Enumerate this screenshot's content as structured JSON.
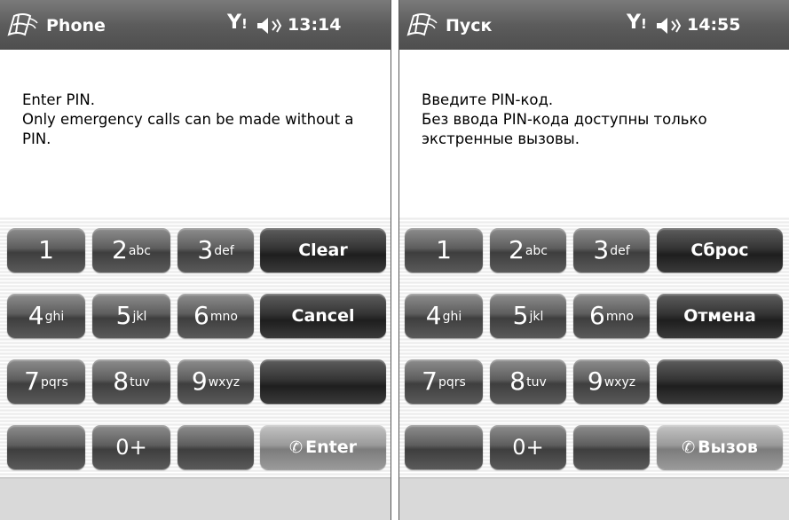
{
  "panels": [
    {
      "title": "Phone",
      "time": "13:14",
      "message_lines": [
        "Enter PIN.",
        "Only emergency calls can be made without a PIN."
      ],
      "keys": {
        "k1": "1",
        "k2": {
          "digit": "2",
          "letters": "abc"
        },
        "k3": {
          "digit": "3",
          "letters": "def"
        },
        "k4": {
          "digit": "4",
          "letters": "ghi"
        },
        "k5": {
          "digit": "5",
          "letters": "jkl"
        },
        "k6": {
          "digit": "6",
          "letters": "mno"
        },
        "k7": {
          "digit": "7",
          "letters": "pqrs"
        },
        "k8": {
          "digit": "8",
          "letters": "tuv"
        },
        "k9": {
          "digit": "9",
          "letters": "wxyz"
        },
        "k0": "0+",
        "clear": "Clear",
        "cancel": "Cancel",
        "enter": "Enter"
      }
    },
    {
      "title": "Пуск",
      "time": "14:55",
      "message_lines": [
        "Введите PIN-код.",
        "Без ввода PIN-кода доступны только экстренные вызовы."
      ],
      "keys": {
        "k1": "1",
        "k2": {
          "digit": "2",
          "letters": "abc"
        },
        "k3": {
          "digit": "3",
          "letters": "def"
        },
        "k4": {
          "digit": "4",
          "letters": "ghi"
        },
        "k5": {
          "digit": "5",
          "letters": "jkl"
        },
        "k6": {
          "digit": "6",
          "letters": "mno"
        },
        "k7": {
          "digit": "7",
          "letters": "pqrs"
        },
        "k8": {
          "digit": "8",
          "letters": "tuv"
        },
        "k9": {
          "digit": "9",
          "letters": "wxyz"
        },
        "k0": "0+",
        "clear": "Сброс",
        "cancel": "Отмена",
        "enter": "Вызов"
      }
    }
  ],
  "icons": {
    "start": "windows-flag-icon",
    "signal": "signal-antenna-icon",
    "volume": "speaker-icon",
    "call": "phone-handset-icon"
  }
}
